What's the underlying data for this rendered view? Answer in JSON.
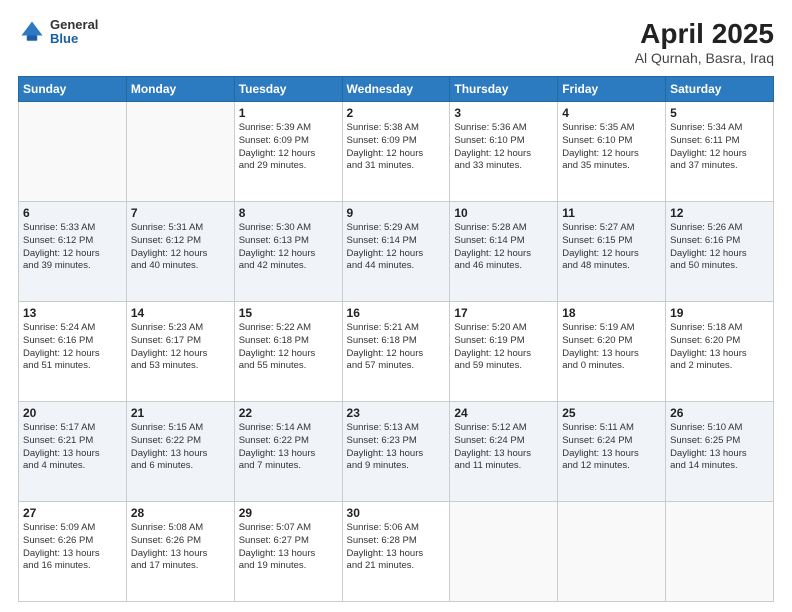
{
  "header": {
    "logo_general": "General",
    "logo_blue": "Blue",
    "title": "April 2025",
    "subtitle": "Al Qurnah, Basra, Iraq"
  },
  "days_of_week": [
    "Sunday",
    "Monday",
    "Tuesday",
    "Wednesday",
    "Thursday",
    "Friday",
    "Saturday"
  ],
  "weeks": [
    [
      {
        "day": "",
        "info": ""
      },
      {
        "day": "",
        "info": ""
      },
      {
        "day": "1",
        "info": "Sunrise: 5:39 AM\nSunset: 6:09 PM\nDaylight: 12 hours\nand 29 minutes."
      },
      {
        "day": "2",
        "info": "Sunrise: 5:38 AM\nSunset: 6:09 PM\nDaylight: 12 hours\nand 31 minutes."
      },
      {
        "day": "3",
        "info": "Sunrise: 5:36 AM\nSunset: 6:10 PM\nDaylight: 12 hours\nand 33 minutes."
      },
      {
        "day": "4",
        "info": "Sunrise: 5:35 AM\nSunset: 6:10 PM\nDaylight: 12 hours\nand 35 minutes."
      },
      {
        "day": "5",
        "info": "Sunrise: 5:34 AM\nSunset: 6:11 PM\nDaylight: 12 hours\nand 37 minutes."
      }
    ],
    [
      {
        "day": "6",
        "info": "Sunrise: 5:33 AM\nSunset: 6:12 PM\nDaylight: 12 hours\nand 39 minutes."
      },
      {
        "day": "7",
        "info": "Sunrise: 5:31 AM\nSunset: 6:12 PM\nDaylight: 12 hours\nand 40 minutes."
      },
      {
        "day": "8",
        "info": "Sunrise: 5:30 AM\nSunset: 6:13 PM\nDaylight: 12 hours\nand 42 minutes."
      },
      {
        "day": "9",
        "info": "Sunrise: 5:29 AM\nSunset: 6:14 PM\nDaylight: 12 hours\nand 44 minutes."
      },
      {
        "day": "10",
        "info": "Sunrise: 5:28 AM\nSunset: 6:14 PM\nDaylight: 12 hours\nand 46 minutes."
      },
      {
        "day": "11",
        "info": "Sunrise: 5:27 AM\nSunset: 6:15 PM\nDaylight: 12 hours\nand 48 minutes."
      },
      {
        "day": "12",
        "info": "Sunrise: 5:26 AM\nSunset: 6:16 PM\nDaylight: 12 hours\nand 50 minutes."
      }
    ],
    [
      {
        "day": "13",
        "info": "Sunrise: 5:24 AM\nSunset: 6:16 PM\nDaylight: 12 hours\nand 51 minutes."
      },
      {
        "day": "14",
        "info": "Sunrise: 5:23 AM\nSunset: 6:17 PM\nDaylight: 12 hours\nand 53 minutes."
      },
      {
        "day": "15",
        "info": "Sunrise: 5:22 AM\nSunset: 6:18 PM\nDaylight: 12 hours\nand 55 minutes."
      },
      {
        "day": "16",
        "info": "Sunrise: 5:21 AM\nSunset: 6:18 PM\nDaylight: 12 hours\nand 57 minutes."
      },
      {
        "day": "17",
        "info": "Sunrise: 5:20 AM\nSunset: 6:19 PM\nDaylight: 12 hours\nand 59 minutes."
      },
      {
        "day": "18",
        "info": "Sunrise: 5:19 AM\nSunset: 6:20 PM\nDaylight: 13 hours\nand 0 minutes."
      },
      {
        "day": "19",
        "info": "Sunrise: 5:18 AM\nSunset: 6:20 PM\nDaylight: 13 hours\nand 2 minutes."
      }
    ],
    [
      {
        "day": "20",
        "info": "Sunrise: 5:17 AM\nSunset: 6:21 PM\nDaylight: 13 hours\nand 4 minutes."
      },
      {
        "day": "21",
        "info": "Sunrise: 5:15 AM\nSunset: 6:22 PM\nDaylight: 13 hours\nand 6 minutes."
      },
      {
        "day": "22",
        "info": "Sunrise: 5:14 AM\nSunset: 6:22 PM\nDaylight: 13 hours\nand 7 minutes."
      },
      {
        "day": "23",
        "info": "Sunrise: 5:13 AM\nSunset: 6:23 PM\nDaylight: 13 hours\nand 9 minutes."
      },
      {
        "day": "24",
        "info": "Sunrise: 5:12 AM\nSunset: 6:24 PM\nDaylight: 13 hours\nand 11 minutes."
      },
      {
        "day": "25",
        "info": "Sunrise: 5:11 AM\nSunset: 6:24 PM\nDaylight: 13 hours\nand 12 minutes."
      },
      {
        "day": "26",
        "info": "Sunrise: 5:10 AM\nSunset: 6:25 PM\nDaylight: 13 hours\nand 14 minutes."
      }
    ],
    [
      {
        "day": "27",
        "info": "Sunrise: 5:09 AM\nSunset: 6:26 PM\nDaylight: 13 hours\nand 16 minutes."
      },
      {
        "day": "28",
        "info": "Sunrise: 5:08 AM\nSunset: 6:26 PM\nDaylight: 13 hours\nand 17 minutes."
      },
      {
        "day": "29",
        "info": "Sunrise: 5:07 AM\nSunset: 6:27 PM\nDaylight: 13 hours\nand 19 minutes."
      },
      {
        "day": "30",
        "info": "Sunrise: 5:06 AM\nSunset: 6:28 PM\nDaylight: 13 hours\nand 21 minutes."
      },
      {
        "day": "",
        "info": ""
      },
      {
        "day": "",
        "info": ""
      },
      {
        "day": "",
        "info": ""
      }
    ]
  ]
}
